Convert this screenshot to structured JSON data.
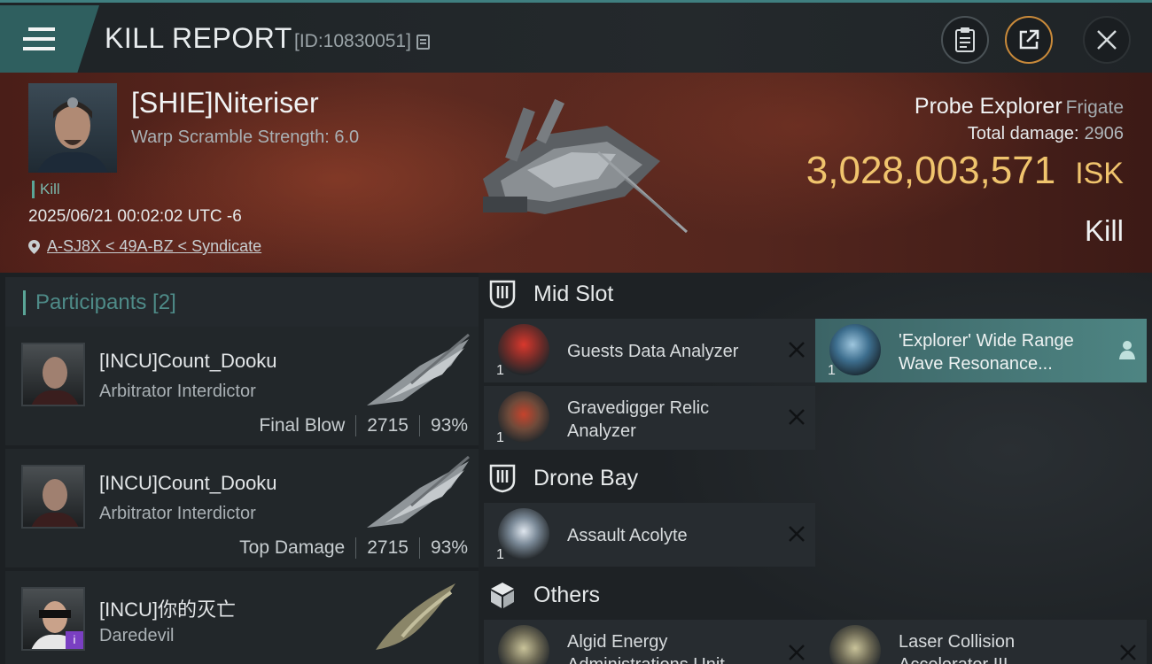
{
  "header": {
    "title": "KILL REPORT",
    "report_id": "[ID:10830051]"
  },
  "victim": {
    "name": "[SHIE]Niteriser",
    "scramble": "Warp Scramble Strength: 6.0",
    "kill_tag": "Kill",
    "datetime": "2025/06/21 00:02:02 UTC -6",
    "location": "A-SJ8X < 49A-BZ < Syndicate",
    "ship_name": "Probe Explorer",
    "ship_class": "Frigate",
    "total_damage_label": "Total damage:",
    "total_damage": "2906",
    "isk_value": "3,028,003,571",
    "isk_unit": "ISK",
    "result": "Kill"
  },
  "participants": {
    "label": "Participants [2]",
    "list": [
      {
        "name": "[INCU]Count_Dooku",
        "ship": "Arbitrator Interdictor",
        "role": "Final Blow",
        "damage": "2715",
        "percent": "93%"
      },
      {
        "name": "[INCU]Count_Dooku",
        "ship": "Arbitrator Interdictor",
        "role": "Top Damage",
        "damage": "2715",
        "percent": "93%"
      },
      {
        "name": "[INCU]你的灭亡",
        "ship": "Daredevil",
        "badge": "i"
      }
    ]
  },
  "fitting": {
    "mid_slot": {
      "label": "Mid Slot",
      "items": [
        {
          "name": "Guests Data Analyzer",
          "qty": "1"
        },
        {
          "name_line1": "'Explorer' Wide Range",
          "name_line2": "Wave Resonance...",
          "qty": "1"
        },
        {
          "name_line1": "Gravedigger Relic",
          "name_line2": "Analyzer",
          "qty": "1"
        }
      ]
    },
    "drone_bay": {
      "label": "Drone Bay",
      "items": [
        {
          "name": "Assault Acolyte",
          "qty": "1"
        }
      ]
    },
    "others": {
      "label": "Others",
      "items": [
        {
          "name_line1": "Algid Energy",
          "name_line2": "Administrations Unit"
        },
        {
          "name_line1": "Laser Collision",
          "name_line2": "Accelerator III"
        }
      ]
    }
  },
  "colors": {
    "accent": "#5aa597",
    "isk": "#f0c46d",
    "highlight": "#4e8583"
  }
}
